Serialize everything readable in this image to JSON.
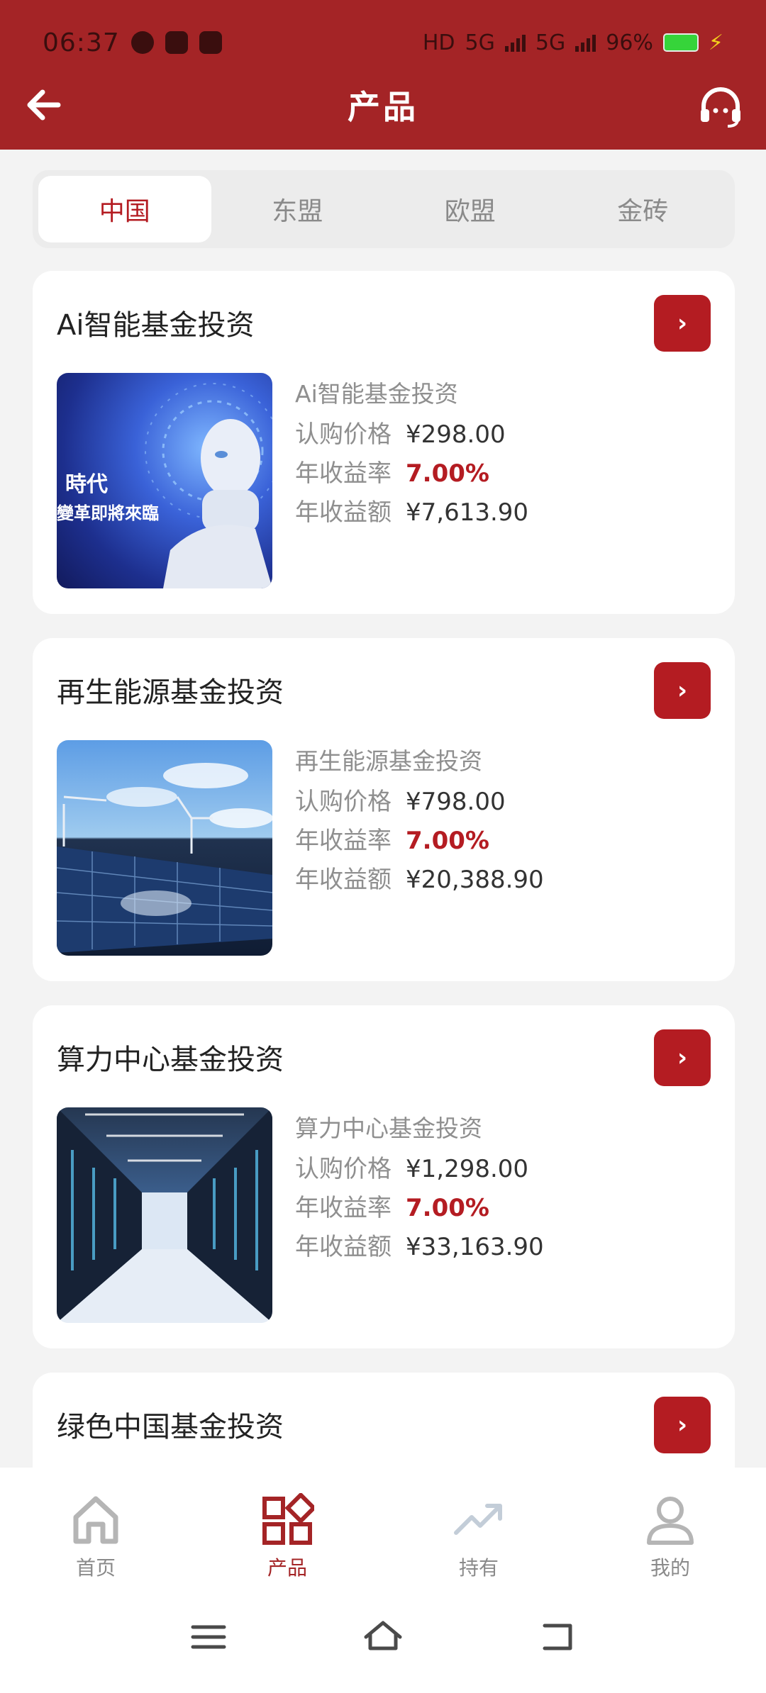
{
  "status_bar": {
    "time": "06:37",
    "hd_label": "HD",
    "sim1": "5G",
    "sim2": "5G",
    "battery": "96%"
  },
  "header": {
    "title": "产品"
  },
  "tabs": [
    {
      "label": "中国",
      "active": true
    },
    {
      "label": "东盟",
      "active": false
    },
    {
      "label": "欧盟",
      "active": false
    },
    {
      "label": "金砖",
      "active": false
    }
  ],
  "labels": {
    "price": "认购价格",
    "rate": "年收益率",
    "income": "年收益额"
  },
  "products": [
    {
      "title": "Ai智能基金投资",
      "subtitle": "Ai智能基金投资",
      "price": "¥298.00",
      "rate": "7.00%",
      "income": "¥7,613.90",
      "image_text_1": "時代",
      "image_text_2": "變革即將來臨"
    },
    {
      "title": "再生能源基金投资",
      "subtitle": "再生能源基金投资",
      "price": "¥798.00",
      "rate": "7.00%",
      "income": "¥20,388.90"
    },
    {
      "title": "算力中心基金投资",
      "subtitle": "算力中心基金投资",
      "price": "¥1,298.00",
      "rate": "7.00%",
      "income": "¥33,163.90"
    },
    {
      "title": "绿色中国基金投资"
    }
  ],
  "bottom_nav": [
    {
      "label": "首页",
      "icon": "home-icon",
      "active": false
    },
    {
      "label": "产品",
      "icon": "products-icon",
      "active": true
    },
    {
      "label": "持有",
      "icon": "trend-icon",
      "active": false
    },
    {
      "label": "我的",
      "icon": "user-icon",
      "active": false
    }
  ],
  "colors": {
    "brand": "#a42426",
    "accent": "#b41c22"
  }
}
